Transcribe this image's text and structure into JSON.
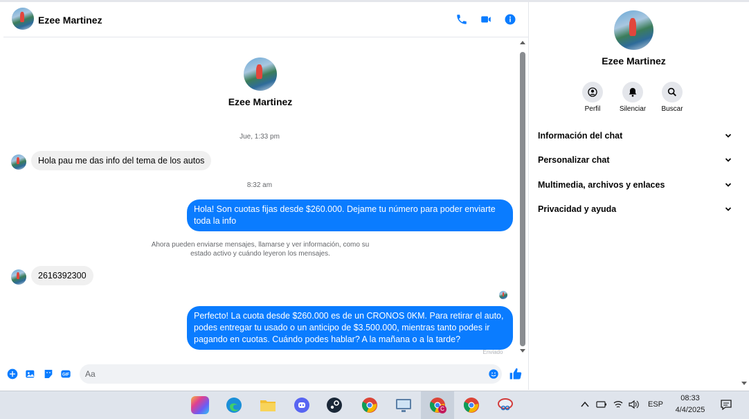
{
  "header": {
    "contact_name": "Ezee Martinez"
  },
  "profile_card": {
    "name": "Ezee Martinez"
  },
  "messages": {
    "ts1": "Jue, 1:33 pm",
    "m1": "Hola pau me das info del tema de los autos",
    "ts2": "8:32 am",
    "m2": "Hola! Son cuotas fijas desde $260.000. Dejame tu número para poder enviarte toda la info",
    "notice": "Ahora pueden enviarse mensajes, llamarse y ver información, como su estado activo y cuándo leyeron los mensajes.",
    "m3": "2616392300",
    "m4": "Perfecto! La cuota desde $260.000 es de un CRONOS 0KM. Para retirar el auto, podes entregar tu usado o un anticipo de $3.500.000, mientras tanto podes ir pagando en cuotas. Cuándo podes hablar? A la mañana o a la tarde?",
    "sent_status": "Enviado"
  },
  "composer": {
    "placeholder": "Aa"
  },
  "sidebar": {
    "name": "Ezee Martinez",
    "actions": {
      "profile": "Perfil",
      "mute": "Silenciar",
      "search": "Buscar"
    },
    "sections": {
      "chat_info": "Información del chat",
      "customize": "Personalizar chat",
      "media": "Multimedia, archivos y enlaces",
      "privacy": "Privacidad y ayuda"
    }
  },
  "taskbar": {
    "language": "ESP",
    "time": "08:33",
    "date": "4/4/2025",
    "chrome_profile_badge": "C"
  },
  "colors": {
    "accent": "#0a7cff",
    "bubble_in": "#f0f0f0"
  }
}
